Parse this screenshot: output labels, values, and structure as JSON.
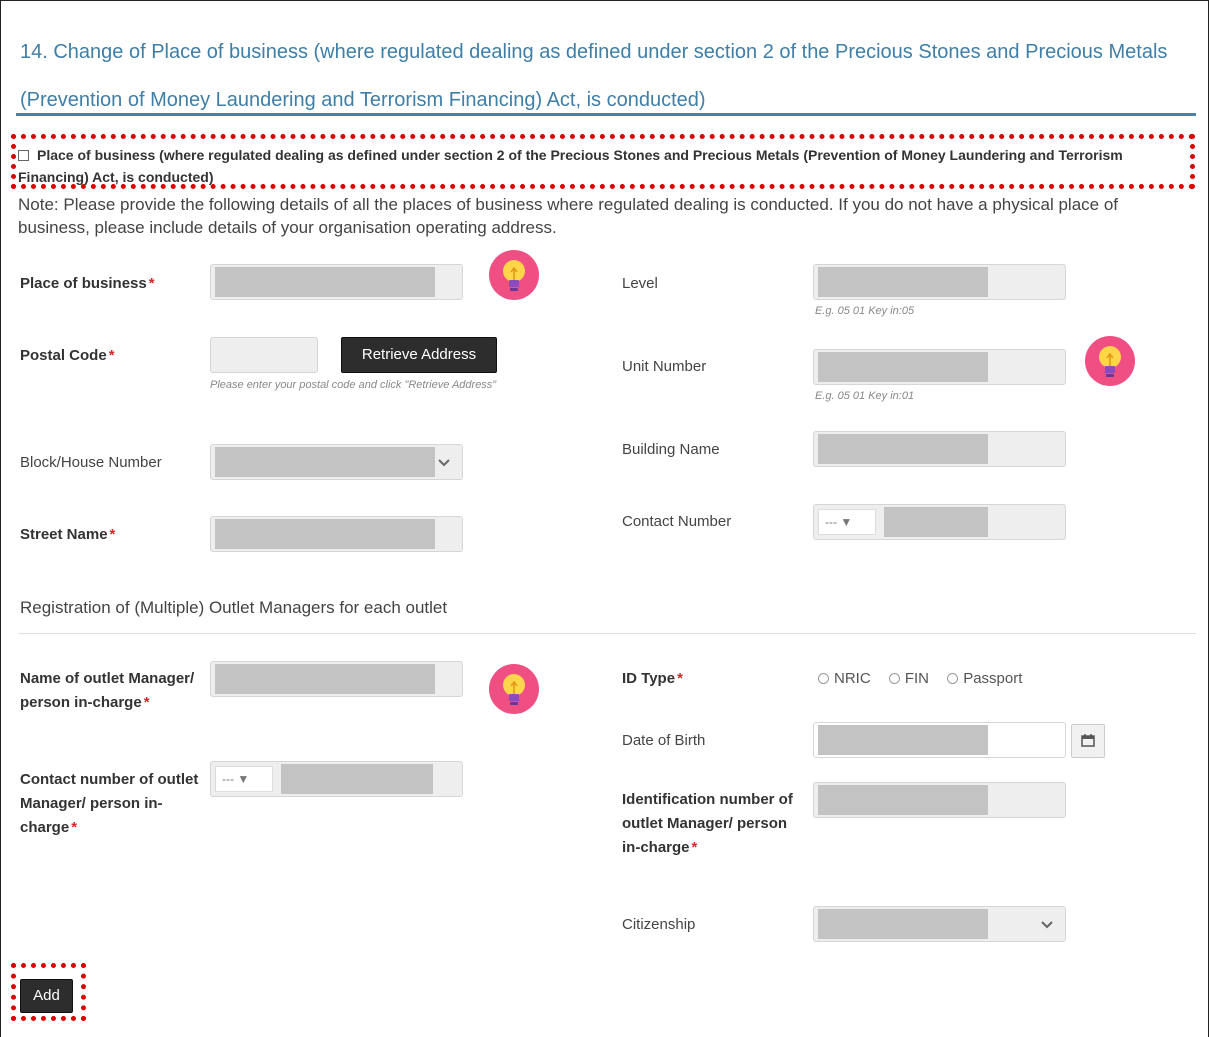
{
  "section": {
    "title": "14. Change of Place of business (where regulated dealing as defined under section 2 of the Precious Stones and Precious Metals (Prevention of Money Laundering and Terrorism Financing) Act, is conducted)"
  },
  "checkbox": {
    "label": "Place of business (where regulated dealing as defined under section 2 of the Precious Stones and Precious Metals (Prevention of Money Laundering and Terrorism Financing) Act, is conducted)"
  },
  "note": "Note: Please provide the following details of all the places of business where regulated dealing is conducted. If you do not have a physical place of business, please include details of your organisation operating address.",
  "required_mark": "*",
  "address": {
    "place_of_business_label": "Place of business",
    "postal_code_label": "Postal Code",
    "retrieve_button": "Retrieve Address",
    "postal_hint": "Please enter your postal code and click \"Retrieve Address\"",
    "block_label": "Block/House Number",
    "street_label": "Street Name",
    "level_label": "Level",
    "level_hint": "E.g. 05 01 Key in:05",
    "unit_label": "Unit Number",
    "unit_hint": "E.g. 05 01 Key in:01",
    "building_label": "Building Name",
    "contact_label": "Contact Number",
    "contact_code_placeholder": "---"
  },
  "managers": {
    "heading": "Registration of (Multiple) Outlet Managers for each outlet",
    "name_label": "Name of outlet Manager/ person in-charge",
    "contact_label": "Contact number of outlet Manager/ person in-charge",
    "contact_code_placeholder": "---",
    "id_type_label": "ID Type",
    "id_type_options": [
      "NRIC",
      "FIN",
      "Passport"
    ],
    "dob_label": "Date of Birth",
    "id_number_label": "Identification number of outlet Manager/ person in-charge",
    "citizenship_label": "Citizenship"
  },
  "add_button": "Add",
  "colors": {
    "title": "#3f7ea6",
    "highlight": "#d90000",
    "required": "#d9262c",
    "bulb_bg": "#f04f84",
    "bulb": "#ffd54a"
  },
  "icons": [
    "lightbulb-icon",
    "chevron-down-icon",
    "caret-down-icon",
    "calendar-icon"
  ]
}
